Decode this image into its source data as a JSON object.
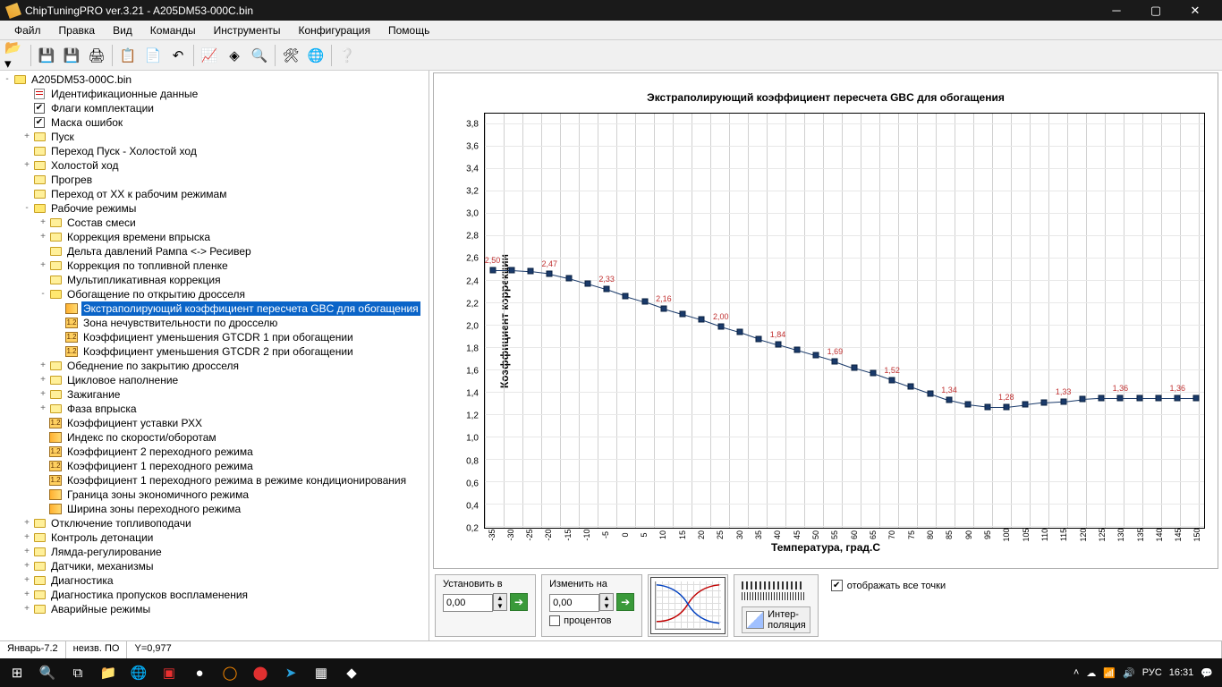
{
  "window": {
    "title": "ChipTuningPRO ver.3.21 - A205DM53-000C.bin"
  },
  "menu": {
    "items": [
      "Файл",
      "Правка",
      "Вид",
      "Команды",
      "Инструменты",
      "Конфигурация",
      "Помощь"
    ]
  },
  "tree": {
    "root": "A205DM53-000C.bin",
    "items": [
      {
        "d": 1,
        "tw": "",
        "ic": "sheet",
        "label": "Идентификационные данные"
      },
      {
        "d": 1,
        "tw": "",
        "ic": "chk",
        "label": "Флаги комплектации"
      },
      {
        "d": 1,
        "tw": "",
        "ic": "chk",
        "label": "Маска ошибок"
      },
      {
        "d": 1,
        "tw": "+",
        "ic": "folder",
        "label": "Пуск"
      },
      {
        "d": 1,
        "tw": "",
        "ic": "folder",
        "label": "Переход Пуск - Холостой ход"
      },
      {
        "d": 1,
        "tw": "+",
        "ic": "folder",
        "label": "Холостой ход"
      },
      {
        "d": 1,
        "tw": "",
        "ic": "folder",
        "label": "Прогрев"
      },
      {
        "d": 1,
        "tw": "",
        "ic": "folder",
        "label": "Переход от ХХ к рабочим режимам"
      },
      {
        "d": 1,
        "tw": "-",
        "ic": "folder-open",
        "label": "Рабочие режимы"
      },
      {
        "d": 2,
        "tw": "+",
        "ic": "folder",
        "label": "Состав смеси"
      },
      {
        "d": 2,
        "tw": "+",
        "ic": "folder",
        "label": "Коррекция времени впрыска"
      },
      {
        "d": 2,
        "tw": "",
        "ic": "folder",
        "label": "Дельта давлений Рампа <-> Ресивер"
      },
      {
        "d": 2,
        "tw": "+",
        "ic": "folder",
        "label": "Коррекция по топливной пленке"
      },
      {
        "d": 2,
        "tw": "",
        "ic": "folder",
        "label": "Мультипликативная коррекция"
      },
      {
        "d": 2,
        "tw": "-",
        "ic": "folder-open",
        "label": "Обогащение по открытию дросселя"
      },
      {
        "d": 3,
        "tw": "",
        "ic": "wig",
        "label": "Экстраполирующий коэффициент пересчета GBC для обогащения",
        "sel": true
      },
      {
        "d": 3,
        "tw": "",
        "ic": "t12",
        "label": "Зона нечувствительности по дросселю"
      },
      {
        "d": 3,
        "tw": "",
        "ic": "t12",
        "label": "Коэффициент уменьшения GTCDR 1 при обогащении"
      },
      {
        "d": 3,
        "tw": "",
        "ic": "t12",
        "label": "Коэффициент уменьшения GTCDR 2 при обогащении"
      },
      {
        "d": 2,
        "tw": "+",
        "ic": "folder",
        "label": "Обеднение по закрытию дросселя"
      },
      {
        "d": 2,
        "tw": "+",
        "ic": "folder",
        "label": "Цикловое наполнение"
      },
      {
        "d": 2,
        "tw": "+",
        "ic": "folder",
        "label": "Зажигание"
      },
      {
        "d": 2,
        "tw": "+",
        "ic": "folder",
        "label": "Фаза впрыска"
      },
      {
        "d": 2,
        "tw": "",
        "ic": "t12",
        "label": "Коэффициент уставки РХХ"
      },
      {
        "d": 2,
        "tw": "",
        "ic": "wig",
        "label": "Индекс по скорости/оборотам"
      },
      {
        "d": 2,
        "tw": "",
        "ic": "t12",
        "label": "Коэффициент 2 переходного режима"
      },
      {
        "d": 2,
        "tw": "",
        "ic": "t12",
        "label": "Коэффициент 1 переходного режима"
      },
      {
        "d": 2,
        "tw": "",
        "ic": "t12",
        "label": "Коэффициент 1 переходного режима в режиме кондиционирования"
      },
      {
        "d": 2,
        "tw": "",
        "ic": "wig",
        "label": "Граница зоны экономичного режима"
      },
      {
        "d": 2,
        "tw": "",
        "ic": "wig",
        "label": "Ширина зоны переходного режима"
      },
      {
        "d": 1,
        "tw": "+",
        "ic": "folder",
        "label": "Отключение топливоподачи"
      },
      {
        "d": 1,
        "tw": "+",
        "ic": "folder",
        "label": "Контроль детонации"
      },
      {
        "d": 1,
        "tw": "+",
        "ic": "folder",
        "label": "Лямда-регулирование"
      },
      {
        "d": 1,
        "tw": "+",
        "ic": "folder",
        "label": "Датчики, механизмы"
      },
      {
        "d": 1,
        "tw": "+",
        "ic": "folder",
        "label": "Диагностика"
      },
      {
        "d": 1,
        "tw": "+",
        "ic": "folder",
        "label": "Диагностика пропусков воспламенения"
      },
      {
        "d": 1,
        "tw": "+",
        "ic": "folder",
        "label": "Аварийные режимы"
      }
    ]
  },
  "chart_data": {
    "type": "line",
    "title": "Экстраполирующий коэффициент пересчета GBC для обогащения",
    "xlabel": "Температура, град.C",
    "ylabel": "Коэффициент коррекции",
    "x_ticks": [
      -35,
      -30,
      -25,
      -20,
      -15,
      -10,
      -5,
      0,
      5,
      10,
      15,
      20,
      25,
      30,
      35,
      40,
      45,
      50,
      55,
      60,
      65,
      70,
      75,
      80,
      85,
      90,
      95,
      100,
      105,
      110,
      115,
      120,
      125,
      130,
      135,
      140,
      145,
      150
    ],
    "y_ticks": [
      0.2,
      0.4,
      0.6,
      0.8,
      1.0,
      1.2,
      1.4,
      1.6,
      1.8,
      2.0,
      2.2,
      2.4,
      2.6,
      2.8,
      3.0,
      3.2,
      3.4,
      3.6,
      3.8
    ],
    "ylim": [
      0.2,
      3.9
    ],
    "xlim": [
      -37,
      152
    ],
    "data_labels": [
      {
        "x": -35,
        "text": "2,50"
      },
      {
        "x": -20,
        "text": "2,47"
      },
      {
        "x": -5,
        "text": "2,33"
      },
      {
        "x": 10,
        "text": "2,16"
      },
      {
        "x": 25,
        "text": "2,00"
      },
      {
        "x": 40,
        "text": "1,84"
      },
      {
        "x": 55,
        "text": "1,69"
      },
      {
        "x": 70,
        "text": "1,52"
      },
      {
        "x": 85,
        "text": "1,34"
      },
      {
        "x": 100,
        "text": "1,28"
      },
      {
        "x": 115,
        "text": "1,33"
      },
      {
        "x": 130,
        "text": "1,36"
      },
      {
        "x": 145,
        "text": "1,36"
      }
    ],
    "series": [
      {
        "name": "coef",
        "x": [
          -35,
          -30,
          -25,
          -20,
          -15,
          -10,
          -5,
          0,
          5,
          10,
          15,
          20,
          25,
          30,
          35,
          40,
          45,
          50,
          55,
          60,
          65,
          70,
          75,
          80,
          85,
          90,
          95,
          100,
          105,
          110,
          115,
          120,
          125,
          130,
          135,
          140,
          145,
          150
        ],
        "y": [
          2.5,
          2.5,
          2.49,
          2.47,
          2.43,
          2.38,
          2.33,
          2.27,
          2.22,
          2.16,
          2.11,
          2.06,
          2.0,
          1.95,
          1.89,
          1.84,
          1.79,
          1.74,
          1.69,
          1.63,
          1.58,
          1.52,
          1.46,
          1.4,
          1.34,
          1.3,
          1.28,
          1.28,
          1.3,
          1.32,
          1.33,
          1.35,
          1.36,
          1.36,
          1.36,
          1.36,
          1.36,
          1.36
        ]
      }
    ]
  },
  "controls": {
    "set_label": "Установить в",
    "set_value": "0,00",
    "change_label": "Изменить на",
    "change_value": "0,00",
    "percent_label": "процентов",
    "interp_label": "Интер-\nполяция",
    "display_all_label": "отображать все точки",
    "display_all_checked": true
  },
  "status": {
    "left": "Январь-7.2",
    "mid": "неизв. ПО",
    "right": "Y=0,977"
  },
  "taskbar": {
    "lang": "РУС",
    "time": "16:31"
  }
}
